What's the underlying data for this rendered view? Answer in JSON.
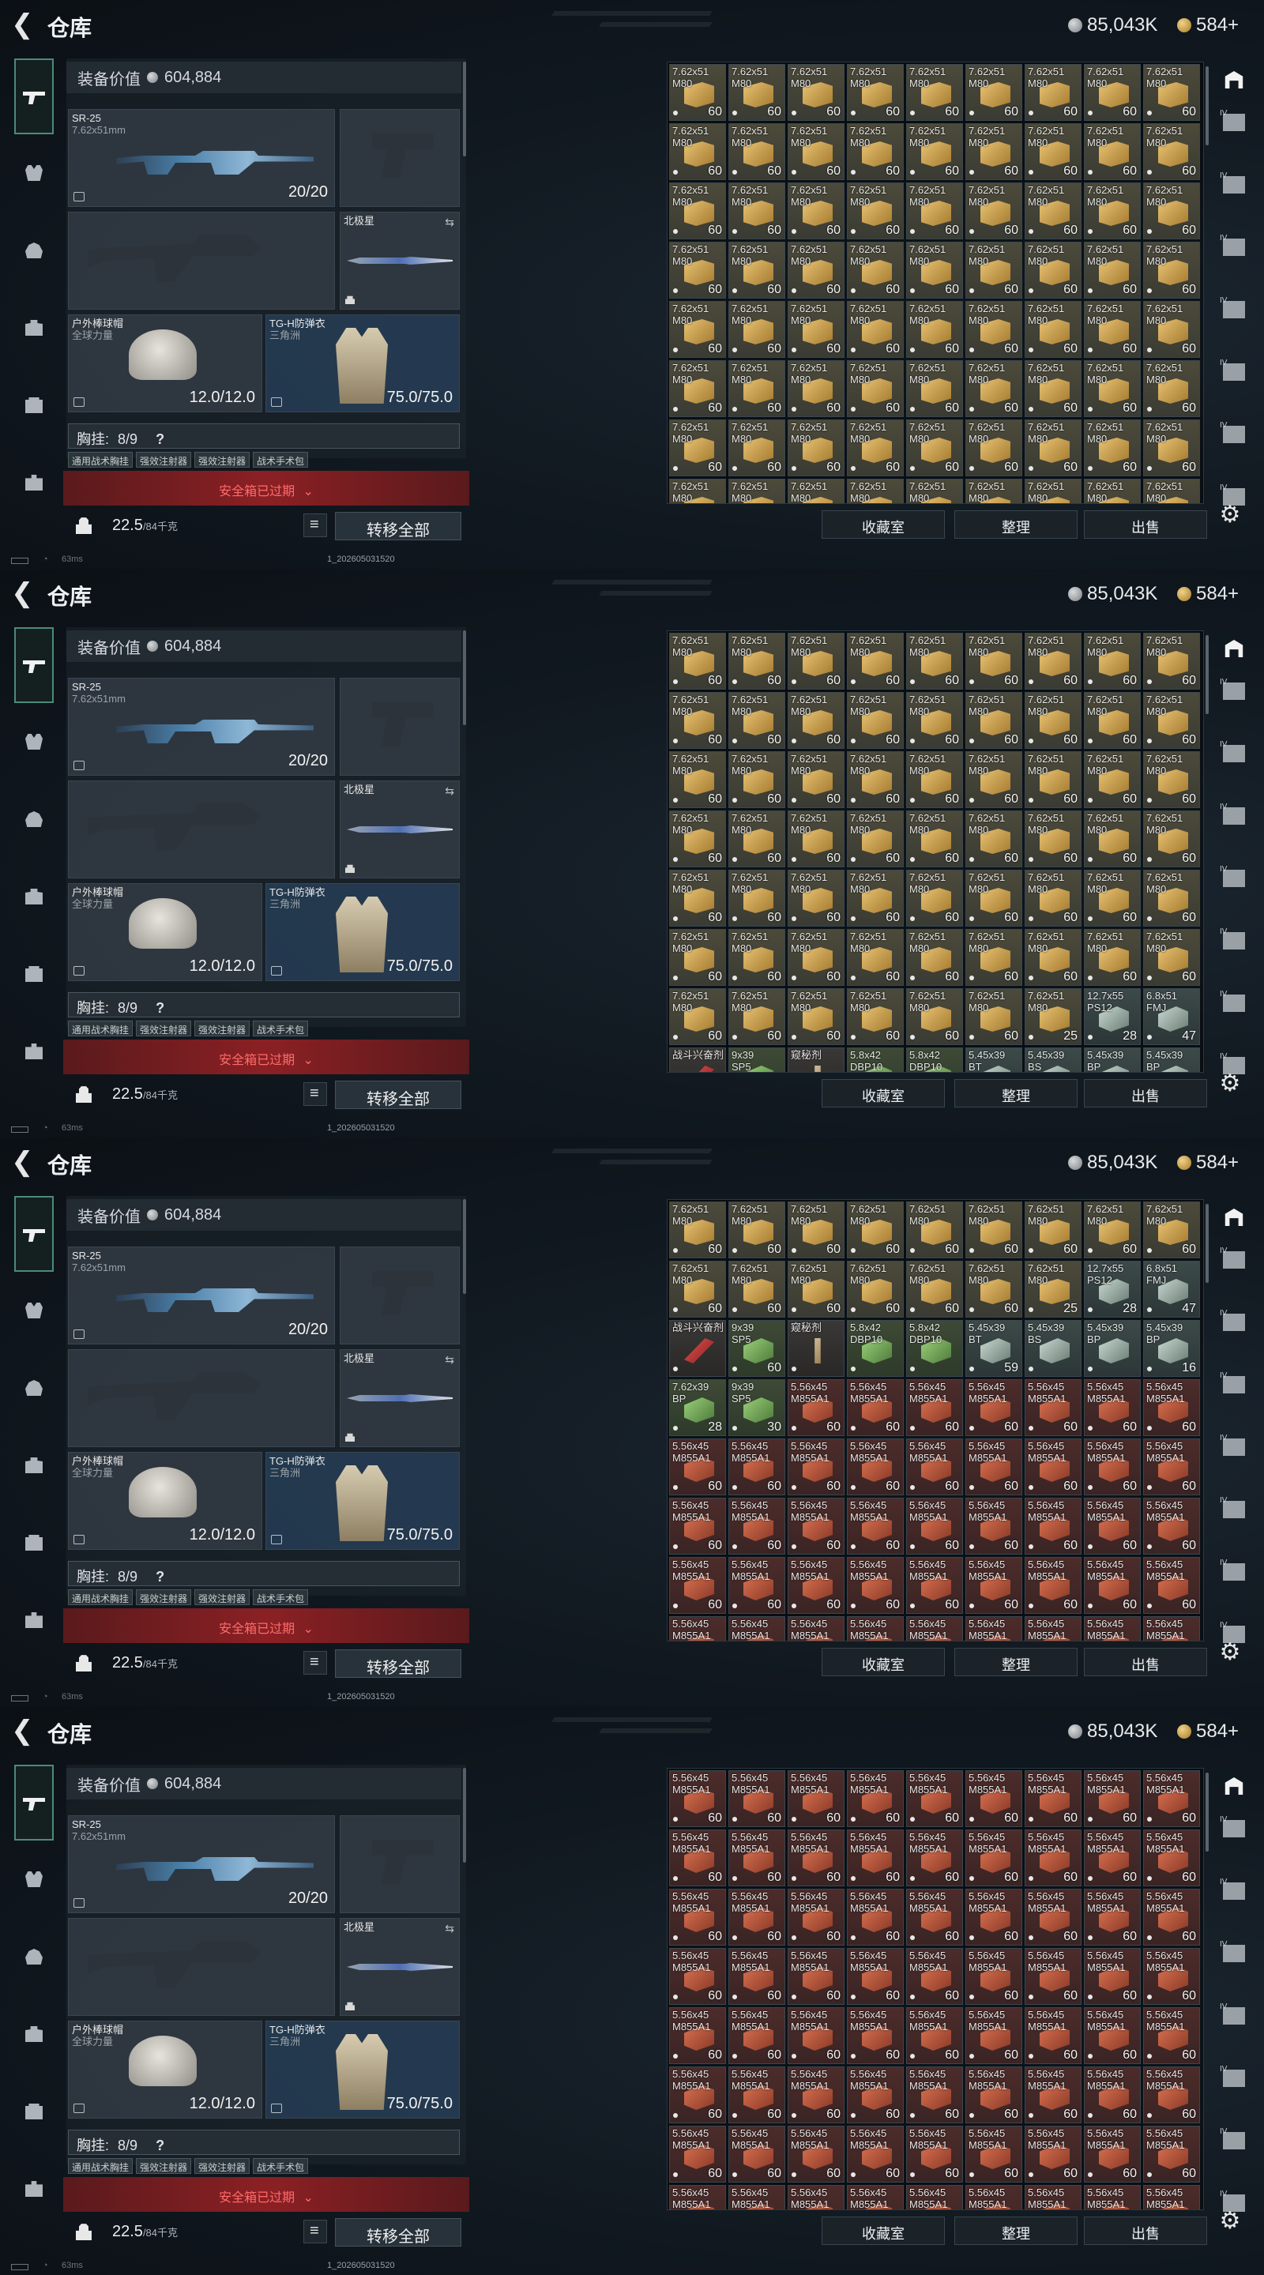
{
  "header": {
    "title": "仓库",
    "silver": "85,043K",
    "gold": "584+"
  },
  "loadout": {
    "equipment_value_label": "装备价值",
    "equipment_value": "604,884",
    "primary": {
      "name": "SR-25",
      "caliber": "7.62x51mm",
      "ammo": "20/20"
    },
    "melee": {
      "name": "北极星"
    },
    "helmet": {
      "name": "户外棒球帽",
      "sub": "全球力量",
      "durability": "12.0/12.0"
    },
    "armor": {
      "name": "TG-H防弹衣",
      "sub": "三角洲",
      "durability": "75.0/75.0"
    },
    "chest_rig": {
      "label": "胸挂:",
      "capacity": "8/9",
      "help": "?"
    },
    "rig_items": [
      "通用战术胸挂",
      "强效注射器",
      "强效注射器",
      "战术手术包"
    ],
    "rig_item_partial": "全球力量",
    "safe_expired": "安全箱已过期",
    "weight": "22.5",
    "weight_max": "/84千克",
    "move_all": "转移全部"
  },
  "status": {
    "ping": "63ms",
    "build": "1_202605031520"
  },
  "buttons": {
    "collection": "收藏室",
    "sort": "整理",
    "sell": "出售"
  },
  "rightnav": [
    "IV",
    "IV",
    "IV",
    "IV",
    "IV",
    "IV",
    "IV",
    "IV"
  ],
  "frames": [
    {
      "id": "frame-1",
      "cells": [
        {
          "t": "7.62x51\nM80",
          "q": "60",
          "k": "ammo762",
          "n": 81
        }
      ]
    },
    {
      "id": "frame-2",
      "cells": [
        {
          "t": "7.62x51\nM80",
          "q": "60",
          "k": "ammo762",
          "n": 54
        },
        {
          "t": "7.62x51\nM80",
          "q": "60",
          "k": "ammo762",
          "n": 6
        },
        {
          "t": "7.62x51\nM80",
          "q": "25",
          "k": "ammo762",
          "n": 1
        },
        {
          "t": "12.7x55\nPS12",
          "q": "28",
          "k": "ammoMisc",
          "n": 1
        },
        {
          "t": "6.8x51\nFMJ",
          "q": "47",
          "k": "ammoMisc",
          "n": 1
        },
        {
          "t": "战斗兴奋剂",
          "q": "",
          "k": "item red",
          "n": 1
        },
        {
          "t": "9x39\nSP5",
          "q": "",
          "k": "ammoGreen",
          "n": 1
        },
        {
          "t": "窥秘剂",
          "q": "",
          "k": "item",
          "n": 1
        },
        {
          "t": "5.8x42\nDBP10",
          "q": "",
          "k": "ammoGreen",
          "n": 1
        },
        {
          "t": "5.8x42\nDBP10",
          "q": "",
          "k": "ammoGreen",
          "n": 1
        },
        {
          "t": "5.45x39\nBT",
          "q": "",
          "k": "ammoMisc",
          "n": 1
        },
        {
          "t": "5.45x39\nBS",
          "q": "",
          "k": "ammoMisc",
          "n": 1
        },
        {
          "t": "5.45x39\nBP",
          "q": "",
          "k": "ammoMisc",
          "n": 1
        },
        {
          "t": "5.45x39\nBP",
          "q": "",
          "k": "ammoMisc",
          "n": 1
        }
      ]
    },
    {
      "id": "frame-3",
      "cells": [
        {
          "t": "7.62x51\nM80",
          "q": "60",
          "k": "ammo762",
          "n": 15
        },
        {
          "t": "7.62x51\nM80",
          "q": "25",
          "k": "ammo762",
          "n": 1
        },
        {
          "t": "12.7x55\nPS12",
          "q": "28",
          "k": "ammoMisc",
          "n": 1
        },
        {
          "t": "6.8x51\nFMJ",
          "q": "47",
          "k": "ammoMisc",
          "n": 1
        },
        {
          "t": "战斗兴奋剂",
          "q": "",
          "k": "item red",
          "n": 1
        },
        {
          "t": "9x39\nSP5",
          "q": "60",
          "k": "ammoGreen",
          "n": 1
        },
        {
          "t": "窥秘剂",
          "q": "",
          "k": "item",
          "n": 1
        },
        {
          "t": "5.8x42\nDBP10",
          "q": "",
          "k": "ammoGreen",
          "n": 1
        },
        {
          "t": "5.8x42\nDBP10",
          "q": "",
          "k": "ammoGreen",
          "n": 1
        },
        {
          "t": "5.45x39\nBT",
          "q": "59",
          "k": "ammoMisc",
          "n": 1
        },
        {
          "t": "5.45x39\nBS",
          "q": "",
          "k": "ammoMisc",
          "n": 1
        },
        {
          "t": "5.45x39\nBP",
          "q": "",
          "k": "ammoMisc",
          "n": 1
        },
        {
          "t": "5.45x39\nBP",
          "q": "16",
          "k": "ammoMisc",
          "n": 1
        },
        {
          "t": "7.62x39\nBP",
          "q": "28",
          "k": "ammoGreen",
          "n": 1
        },
        {
          "t": "9x39\nSP5",
          "q": "30",
          "k": "ammoGreen",
          "n": 1
        },
        {
          "t": "5.56x45\nM855A1",
          "q": "60",
          "k": "ammo556",
          "n": 43
        }
      ]
    },
    {
      "id": "frame-4",
      "cells": [
        {
          "t": "5.56x45\nM855A1",
          "q": "60",
          "k": "ammo556",
          "n": 81
        }
      ]
    }
  ]
}
